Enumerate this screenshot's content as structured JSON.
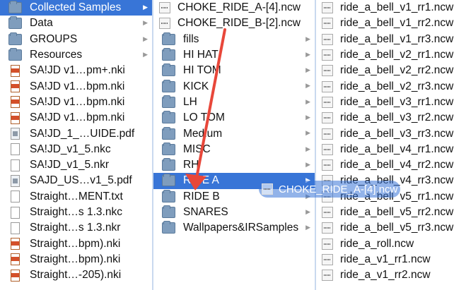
{
  "columns": [
    {
      "items": [
        {
          "label": "Collected Samples",
          "icon": "folder-icon",
          "arrow": true,
          "selected": true
        },
        {
          "label": "Data",
          "icon": "folder-icon",
          "arrow": true
        },
        {
          "label": "GROUPS",
          "icon": "folder-icon",
          "arrow": true
        },
        {
          "label": "Resources",
          "icon": "folder-icon",
          "arrow": true
        },
        {
          "label": "SA!JD v1…pm+.nki",
          "icon": "nki-file-icon"
        },
        {
          "label": "SA!JD v1…bpm.nki",
          "icon": "nki-file-icon"
        },
        {
          "label": "SA!JD v1…bpm.nki",
          "icon": "nki-file-icon"
        },
        {
          "label": "SA!JD v1…bpm.nki",
          "icon": "nki-file-icon"
        },
        {
          "label": "SA!JD_1_…UIDE.pdf",
          "icon": "pdf-file-icon"
        },
        {
          "label": "SA!JD_v1_5.nkc",
          "icon": "document-icon"
        },
        {
          "label": "SA!JD_v1_5.nkr",
          "icon": "document-icon"
        },
        {
          "label": "SAJD_US…v1_5.pdf",
          "icon": "pdf-file-icon"
        },
        {
          "label": "Straight…MENT.txt",
          "icon": "document-icon"
        },
        {
          "label": "Straight…s 1.3.nkc",
          "icon": "document-icon"
        },
        {
          "label": "Straight…s 1.3.nkr",
          "icon": "document-icon"
        },
        {
          "label": "Straight…bpm).nki",
          "icon": "nki-file-icon"
        },
        {
          "label": "Straight…bpm).nki",
          "icon": "nki-file-icon"
        },
        {
          "label": "Straight…-205).nki",
          "icon": "nki-file-icon"
        }
      ]
    },
    {
      "items": [
        {
          "label": "CHOKE_RIDE_A-[4].ncw",
          "icon": "audio-file-icon"
        },
        {
          "label": "CHOKE_RIDE_B-[2].ncw",
          "icon": "audio-file-icon"
        },
        {
          "label": "fills",
          "icon": "folder-icon",
          "arrow": true
        },
        {
          "label": "HI HAT",
          "icon": "folder-icon",
          "arrow": true
        },
        {
          "label": "HI TOM",
          "icon": "folder-icon",
          "arrow": true
        },
        {
          "label": "KICK",
          "icon": "folder-icon",
          "arrow": true
        },
        {
          "label": "LH",
          "icon": "folder-icon",
          "arrow": true
        },
        {
          "label": "LO TOM",
          "icon": "folder-icon",
          "arrow": true
        },
        {
          "label": "Medium",
          "icon": "folder-icon",
          "arrow": true
        },
        {
          "label": "MISC",
          "icon": "folder-icon",
          "arrow": true
        },
        {
          "label": "RH",
          "icon": "folder-icon",
          "arrow": true
        },
        {
          "label": "RIDE A",
          "icon": "folder-icon",
          "arrow": true,
          "selected": true
        },
        {
          "label": "RIDE B",
          "icon": "folder-icon",
          "arrow": true
        },
        {
          "label": "SNARES",
          "icon": "folder-icon",
          "arrow": true
        },
        {
          "label": "Wallpapers&IRSamples",
          "icon": "folder-icon",
          "arrow": true
        }
      ]
    },
    {
      "items": [
        {
          "label": "ride_a_bell_v1_rr1.ncw",
          "icon": "audio-file-icon"
        },
        {
          "label": "ride_a_bell_v1_rr2.ncw",
          "icon": "audio-file-icon"
        },
        {
          "label": "ride_a_bell_v1_rr3.ncw",
          "icon": "audio-file-icon"
        },
        {
          "label": "ride_a_bell_v2_rr1.ncw",
          "icon": "audio-file-icon"
        },
        {
          "label": "ride_a_bell_v2_rr2.ncw",
          "icon": "audio-file-icon"
        },
        {
          "label": "ride_a_bell_v2_rr3.ncw",
          "icon": "audio-file-icon"
        },
        {
          "label": "ride_a_bell_v3_rr1.ncw",
          "icon": "audio-file-icon"
        },
        {
          "label": "ride_a_bell_v3_rr2.ncw",
          "icon": "audio-file-icon"
        },
        {
          "label": "ride_a_bell_v3_rr3.ncw",
          "icon": "audio-file-icon"
        },
        {
          "label": "ride_a_bell_v4_rr1.ncw",
          "icon": "audio-file-icon"
        },
        {
          "label": "ride_a_bell_v4_rr2.ncw",
          "icon": "audio-file-icon"
        },
        {
          "label": "ride_a_bell_v4_rr3.ncw",
          "icon": "audio-file-icon"
        },
        {
          "label": "ride_a_bell_v5_rr1.ncw",
          "icon": "audio-file-icon"
        },
        {
          "label": "ride_a_bell_v5_rr2.ncw",
          "icon": "audio-file-icon"
        },
        {
          "label": "ride_a_bell_v5_rr3.ncw",
          "icon": "audio-file-icon"
        },
        {
          "label": "ride_a_roll.ncw",
          "icon": "audio-file-icon"
        },
        {
          "label": "ride_a_v1_rr1.ncw",
          "icon": "audio-file-icon"
        },
        {
          "label": "ride_a_v1_rr2.ncw",
          "icon": "audio-file-icon"
        }
      ]
    }
  ],
  "drag": {
    "label": "CHOKE_RIDE_A-[4].ncw",
    "icon": "audio-file-icon",
    "arrow_color": "#e8473a"
  },
  "colors": {
    "selection": "#3875d7",
    "divider": "#c9d9ef",
    "folder": "#7f9dbd"
  }
}
